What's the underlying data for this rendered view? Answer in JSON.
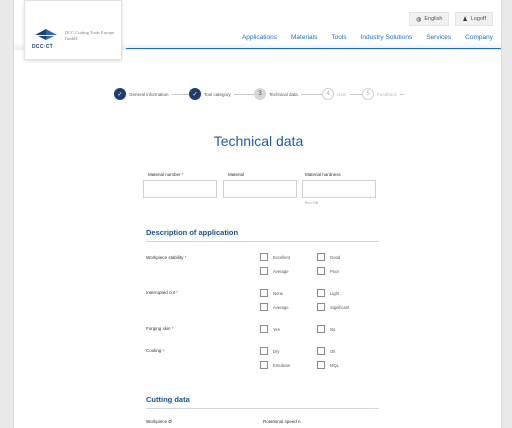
{
  "colors": {
    "brand_blue": "#1a6fc4",
    "heading_blue": "#1a5aa8",
    "step_done": "#1e3c6e",
    "required": "#d32f2f"
  },
  "logo": {
    "brand": "DCC·CT",
    "text": "DCC Cutting Tools Europe GmbH"
  },
  "top_links": [
    {
      "icon": "globe-icon",
      "label": "English"
    },
    {
      "icon": "user-icon",
      "label": "Logoff"
    }
  ],
  "nav": [
    "Applications",
    "Materials",
    "Tools",
    "Industry Solutions",
    "Services",
    "Company"
  ],
  "steps": [
    {
      "num": "✓",
      "label": "General information",
      "state": "done"
    },
    {
      "num": "✓",
      "label": "Tool category",
      "state": "done"
    },
    {
      "num": "3",
      "label": "Technical data",
      "state": "current"
    },
    {
      "num": "4",
      "label": "User",
      "state": "future"
    },
    {
      "num": "5",
      "label": "Feedback",
      "state": "future"
    }
  ],
  "title": "Technical data",
  "fields": {
    "material_number": {
      "label": "Material number",
      "value": ""
    },
    "material": {
      "label": "Material",
      "value": ""
    },
    "hardness": {
      "label": "Material hardness",
      "value": "",
      "hint": "Rm / HB"
    }
  },
  "section_application": "Description of application",
  "questions": [
    {
      "label": "Workpiece stability",
      "options": [
        "Excellent",
        "Good",
        "Average",
        "Poor"
      ]
    },
    {
      "label": "Interrupted cut",
      "options": [
        "None",
        "Light",
        "Average",
        "Significant"
      ]
    },
    {
      "label": "Forging skin",
      "options": [
        "Yes",
        "No"
      ]
    },
    {
      "label": "Cooling",
      "options": [
        "Dry",
        "Oil",
        "Emulsion",
        "MQL"
      ]
    }
  ],
  "section_cutting": "Cutting data",
  "cutting_fields": {
    "workpiece": "Workpiece Ø",
    "speed": "Rotational speed n"
  }
}
